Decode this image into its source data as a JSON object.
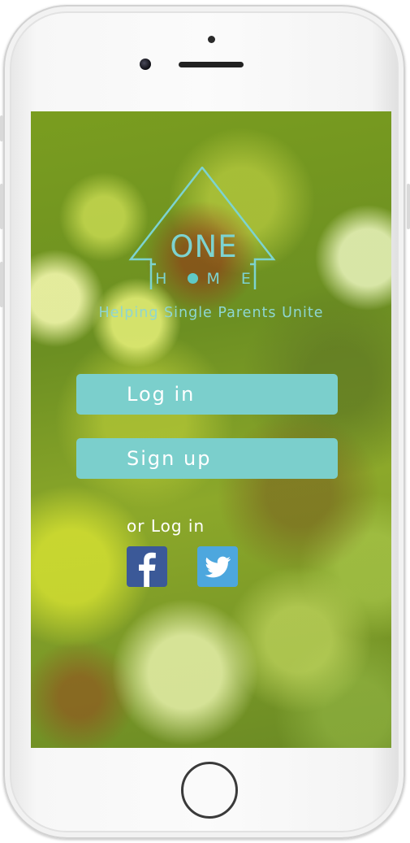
{
  "app": {
    "logo_main": "ONE",
    "logo_sub_letters": [
      "H",
      "M",
      "E"
    ],
    "tagline": "Helping Single Parents Unite"
  },
  "auth": {
    "login_label": "Log in",
    "signup_label": "Sign up",
    "alt_login_label": "or Log in"
  },
  "social": [
    {
      "name": "facebook",
      "icon": "facebook-icon",
      "color": "#3b5998"
    },
    {
      "name": "twitter",
      "icon": "twitter-icon",
      "color": "#4da7de"
    }
  ],
  "colors": {
    "accent": "#7bcfcc",
    "logo": "#7dd3d0",
    "background": "#6c8f22"
  }
}
